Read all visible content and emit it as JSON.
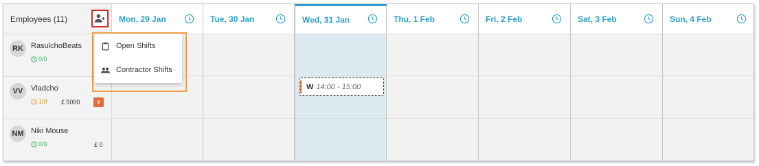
{
  "employees_header": {
    "label": "Employees (11)"
  },
  "days": [
    {
      "label": "Mon, 29 Jan",
      "today": false
    },
    {
      "label": "Tue, 30 Jan",
      "today": false
    },
    {
      "label": "Wed, 31 Jan",
      "today": true
    },
    {
      "label": "Thu, 1 Feb",
      "today": false
    },
    {
      "label": "Fri, 2 Feb",
      "today": false
    },
    {
      "label": "Sat, 3 Feb",
      "today": false
    },
    {
      "label": "Sun, 4 Feb",
      "today": false
    }
  ],
  "employees": [
    {
      "initials": "RK",
      "name": "RasulchoBeats",
      "hours": "0/0",
      "hours_color": "green",
      "pay": "",
      "badge": ""
    },
    {
      "initials": "VV",
      "name": "Vladcho",
      "hours": "1/0",
      "hours_color": "orange",
      "pay": "£ 5000",
      "badge": "Y"
    },
    {
      "initials": "NM",
      "name": "Niki Mouse",
      "hours": "0/0",
      "hours_color": "green",
      "pay": "£ 0",
      "badge": ""
    }
  ],
  "shift": {
    "type": "W",
    "time": "14:00 - 15:00"
  },
  "menu": {
    "items": [
      {
        "label": "Open Shifts",
        "icon": "clipboard-icon"
      },
      {
        "label": "Contractor Shifts",
        "icon": "people-icon"
      }
    ]
  },
  "colors": {
    "accent": "#2c9fd2",
    "today_bg": "#dcebf1",
    "green": "#3fb56b",
    "orange": "#f0962c",
    "badge": "#e26b3a",
    "highlight_red": "#d62c2c",
    "menu_outline": "#f5a04a"
  }
}
